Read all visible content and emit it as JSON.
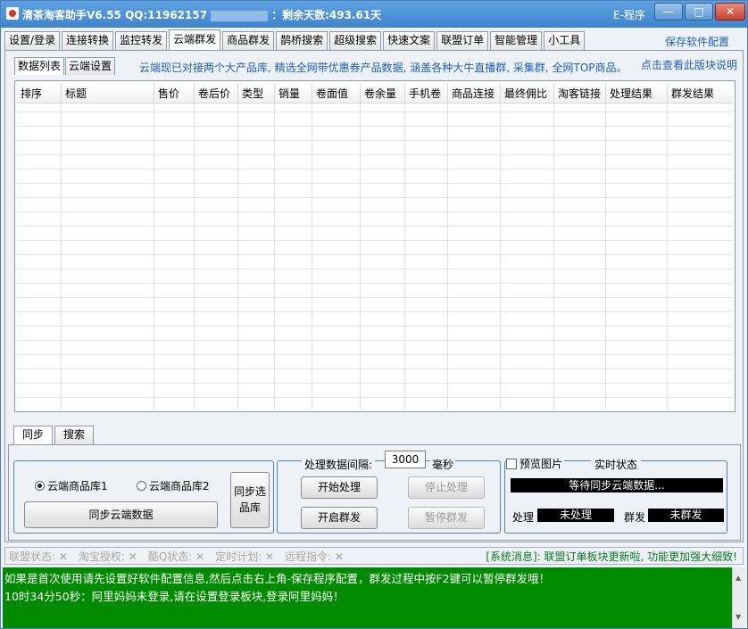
{
  "window": {
    "title": "清茶淘客助手V6.55 QQ:11962157",
    "remaining": "：剩余天数:493.61天",
    "e_program": "E-程序",
    "min_label": "—",
    "max_label": "□",
    "close_label": "✕"
  },
  "top_tabs": [
    "设置/登录",
    "连接转换",
    "监控转发",
    "云端群发",
    "商品群发",
    "鹊桥搜索",
    "超级搜索",
    "快速文案",
    "联盟订单",
    "智能管理",
    "小工具"
  ],
  "active_top_tab": "云端群发",
  "save_config": "保存软件配置",
  "sub_tabs": [
    "数据列表",
    "云端设置"
  ],
  "notice": "云端现已对接两个大产品库, 精选全网带优惠券产品数据, 涵盖各种大牛直播群, 采集群, 全网TOP商品。",
  "help_link": "点击查看此版块说明",
  "columns": [
    "排序",
    "标题",
    "售价",
    "卷后价",
    "类型",
    "销量",
    "卷面值",
    "卷余量",
    "手机卷",
    "商品连接",
    "最终佣比",
    "淘客链接",
    "处理结果",
    "群发结果"
  ],
  "lower_tabs": [
    "同步",
    "搜索"
  ],
  "sync": {
    "radio1": "云端商品库1",
    "radio2": "云端商品库2",
    "radio1_selected": true,
    "sync_button": "同步云端数据",
    "sync_select_line1": "同步选",
    "sync_select_line2": "品库"
  },
  "processing": {
    "interval_label": "处理数据间隔:",
    "interval_value": "3000",
    "interval_unit": "毫秒",
    "start": "开始处理",
    "stop": "停止处理",
    "open_mass": "开启群发",
    "pause_mass": "暂停群发"
  },
  "realtime": {
    "preview_label": "预览图片",
    "title": "实时状态",
    "waiting": "等待同步云端数据...",
    "proc_label": "处理",
    "proc_value": "未处理",
    "mass_label": "群发",
    "mass_value": "未群发"
  },
  "statusbar": [
    "联盟状态: ✕",
    "淘宝授权: ✕",
    "酷Q状态: ✕",
    "定时计划: ✕",
    "远程指令: ✕"
  ],
  "system_message": "[系统消息]: 联盟订单板块更新啦, 功能更加强大细致!",
  "log": [
    "如果是首次使用请先设置好软件配置信息,然后点击右上角-保存程序配置，群发过程中按F2键可以暂停群发哦！",
    "10时34分50秒：阿里妈妈未登录,请在设置登录板块,登录阿里妈妈！"
  ],
  "colors": {
    "title_bar": "#4a8fd6",
    "link_blue": "#1d5fc2",
    "log_bg": "#008a00",
    "sys_green": "#0a7a26"
  }
}
